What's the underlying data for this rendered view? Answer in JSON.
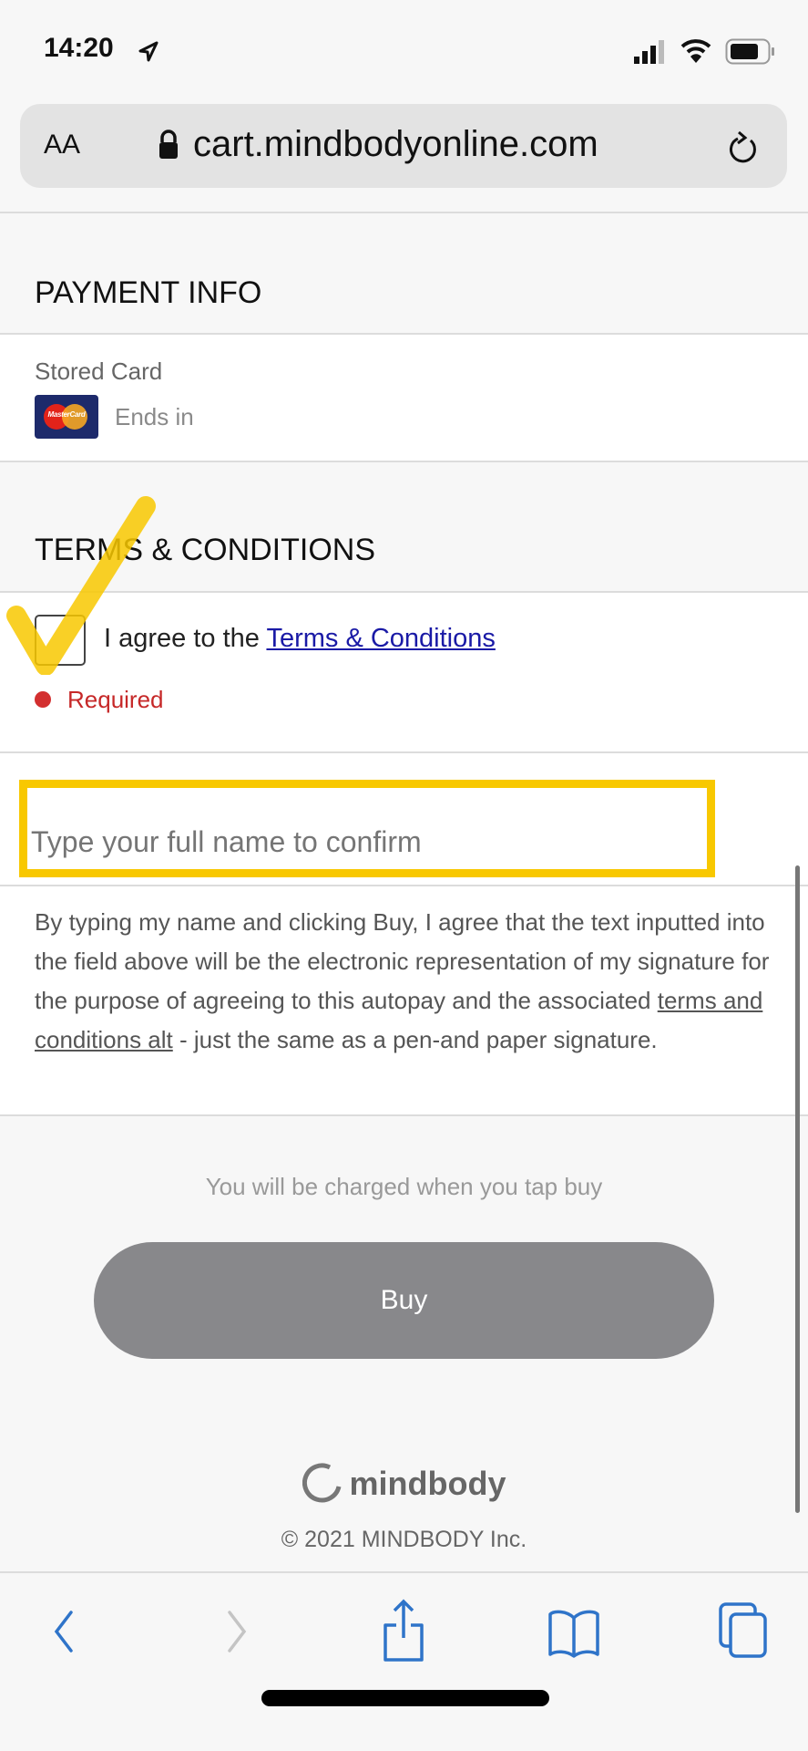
{
  "status_bar": {
    "time": "14:20"
  },
  "browser": {
    "text_size_label": "AA",
    "url": "cart.mindbodyonline.com"
  },
  "payment": {
    "heading": "PAYMENT INFO",
    "stored_card_label": "Stored Card",
    "card_brand": "MasterCard",
    "ends_in": "Ends in"
  },
  "terms": {
    "heading": "TERMS & CONDITIONS",
    "agree_prefix": "I agree to the",
    "agree_link": "Terms & Conditions",
    "required": "Required",
    "checked": false
  },
  "signature": {
    "placeholder": "Type your full name to confirm",
    "value": ""
  },
  "disclaimer": {
    "before": "By typing my name and clicking Buy, I agree that the text inputted into the field above will be the electronic representation of my signature for the purpose of agreeing to this autopay and the associated ",
    "link": "terms and conditions alt",
    "after": " - just the same as a pen-and paper signature."
  },
  "charge_note": "You will be charged when you tap buy",
  "buy_label": "Buy",
  "footer": {
    "logo": "mindbody",
    "copyright": "© 2021 MINDBODY Inc."
  },
  "toolbar": {
    "icons": [
      "back-icon",
      "forward-icon",
      "share-icon",
      "bookmarks-icon",
      "tabs-icon"
    ]
  },
  "colors": {
    "link": "#1a1aa6",
    "required": "#d32f2f",
    "annotation": "#f8c800",
    "toolbar_icon": "#2f74c9",
    "buy_disabled": "#88888b"
  }
}
